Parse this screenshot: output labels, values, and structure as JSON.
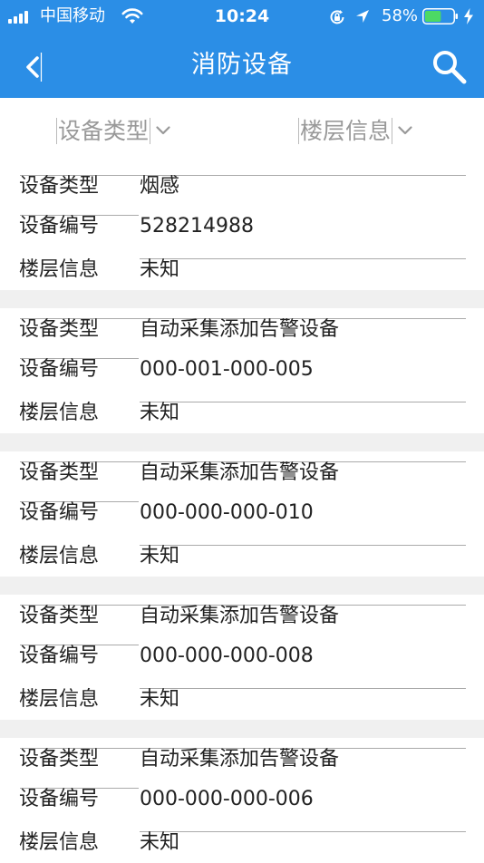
{
  "status_bar": {
    "carrier": "中国移动",
    "time": "10:24",
    "battery_percent": "58%",
    "battery_level": 0.58,
    "icons": [
      "signal-icon",
      "wifi-icon",
      "orientation-lock-icon",
      "location-icon",
      "battery-icon",
      "charging-icon"
    ]
  },
  "nav": {
    "title": "消防设备",
    "back_icon": "chevron-left-icon",
    "search_icon": "search-icon",
    "accent_color": "#2b8ee6"
  },
  "filters": {
    "device_type_label": "设备类型",
    "floor_label": "楼层信息"
  },
  "field_labels": {
    "type": "设备类型",
    "number": "设备编号",
    "floor": "楼层信息"
  },
  "devices": [
    {
      "type": "烟感",
      "number": "528214988",
      "floor": "未知"
    },
    {
      "type": "自动采集添加告警设备",
      "number": "000-001-000-005",
      "floor": "未知"
    },
    {
      "type": "自动采集添加告警设备",
      "number": "000-000-000-010",
      "floor": "未知"
    },
    {
      "type": "自动采集添加告警设备",
      "number": "000-000-000-008",
      "floor": "未知"
    },
    {
      "type": "自动采集添加告警设备",
      "number": "000-000-000-006",
      "floor": "未知"
    }
  ]
}
